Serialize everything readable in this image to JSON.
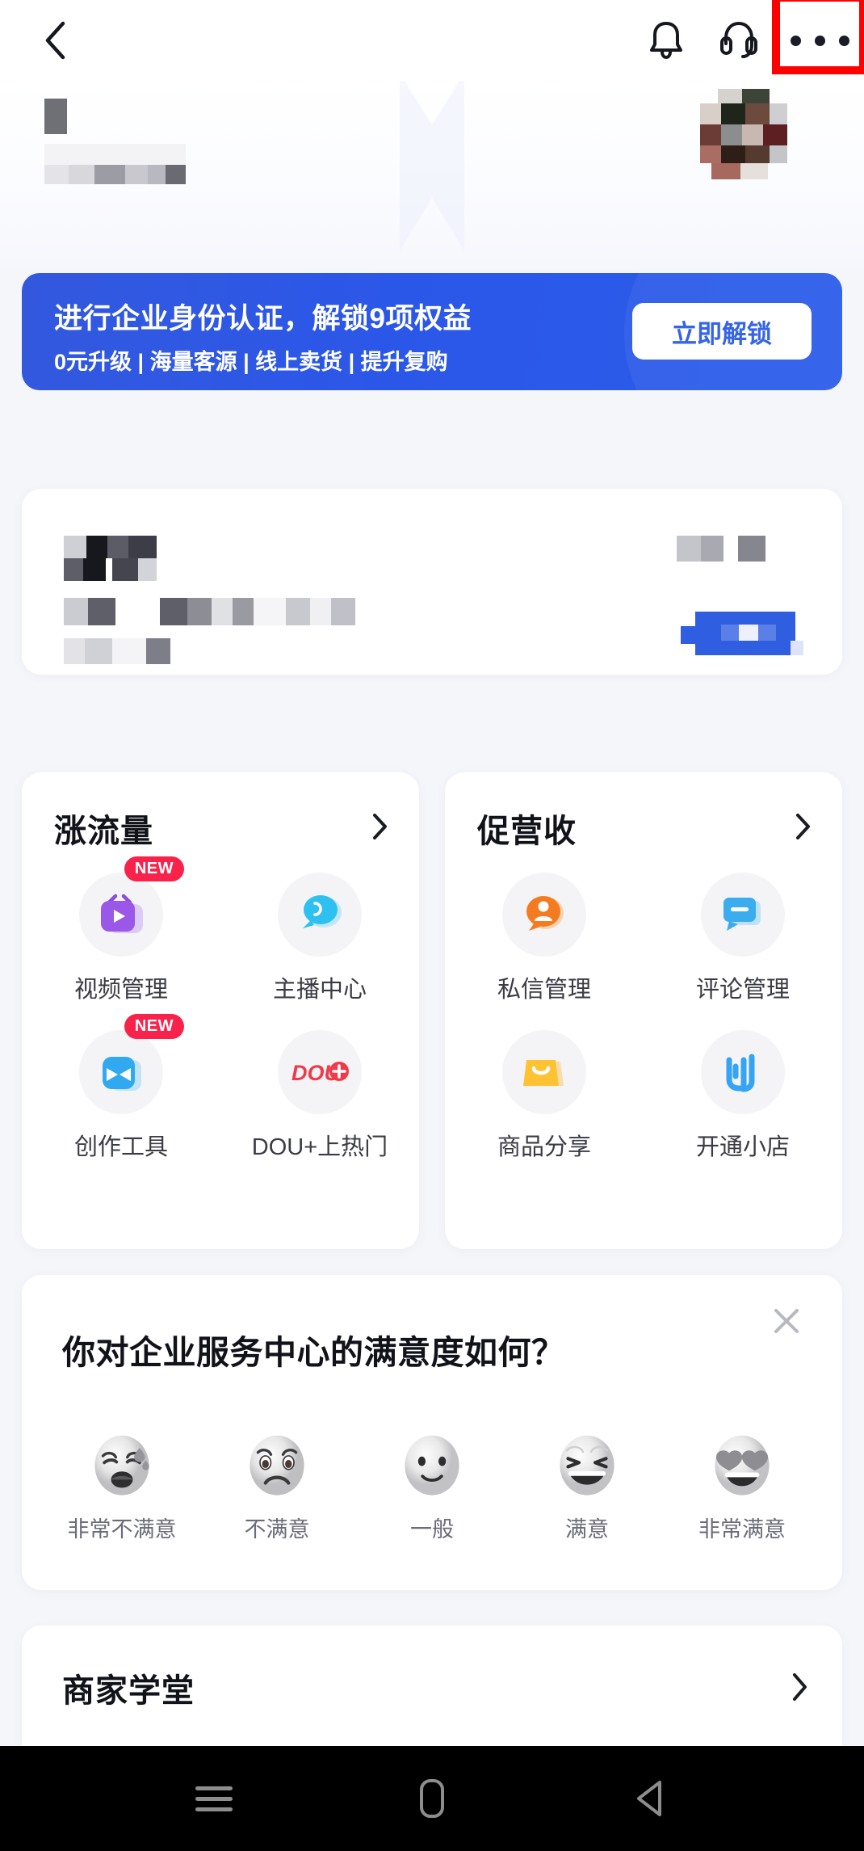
{
  "topbar": {
    "back_icon": "back-chevron-icon",
    "notification_icon": "bell-icon",
    "support_icon": "headset-icon",
    "more_icon": "more-dots-icon",
    "annotation_color": "#FF0000"
  },
  "profile": {
    "name_redacted": true,
    "subtitle_redacted": true,
    "avatar_redacted": true
  },
  "banner": {
    "title": "进行企业身份认证，解锁9项权益",
    "subtitle": "0元升级 | 海量客源 | 线上卖货 | 提升复购",
    "button_label": "立即解锁",
    "bg_color": "#2B57E8",
    "button_text_color": "#2B5CE6"
  },
  "info_card": {
    "redacted": true,
    "button_color": "#2F5FE0"
  },
  "sections": [
    {
      "title": "涨流量",
      "chevron": "chevron-right-icon",
      "items": [
        {
          "label": "视频管理",
          "icon": "video-tv-icon",
          "badge": "NEW"
        },
        {
          "label": "主播中心",
          "icon": "anchor-bubble-icon",
          "badge": ""
        },
        {
          "label": "创作工具",
          "icon": "creation-tools-icon",
          "badge": "NEW"
        },
        {
          "label": "DOU+上热门",
          "icon": "dou-plus-icon",
          "badge": ""
        }
      ]
    },
    {
      "title": "促营收",
      "chevron": "chevron-right-icon",
      "items": [
        {
          "label": "私信管理",
          "icon": "direct-message-icon",
          "badge": ""
        },
        {
          "label": "评论管理",
          "icon": "comment-icon",
          "badge": ""
        },
        {
          "label": "商品分享",
          "icon": "shopping-bag-icon",
          "badge": ""
        },
        {
          "label": "开通小店",
          "icon": "open-shop-icon",
          "badge": ""
        }
      ]
    }
  ],
  "survey": {
    "question": "你对企业服务中心的满意度如何？",
    "close_icon": "close-x-icon",
    "options": [
      {
        "label": "非常不满意",
        "face": "weary-face"
      },
      {
        "label": "不满意",
        "face": "frowning-face"
      },
      {
        "label": "一般",
        "face": "neutral-face"
      },
      {
        "label": "满意",
        "face": "grinning-squint-face"
      },
      {
        "label": "非常满意",
        "face": "heart-eyes-face"
      }
    ]
  },
  "academy": {
    "title": "商家学堂",
    "chevron": "chevron-right-icon"
  },
  "navbar": {
    "recents_icon": "recents-menu-icon",
    "home_icon": "home-icon",
    "back_icon": "back-triangle-icon"
  },
  "badges": {
    "new_label": "NEW"
  }
}
